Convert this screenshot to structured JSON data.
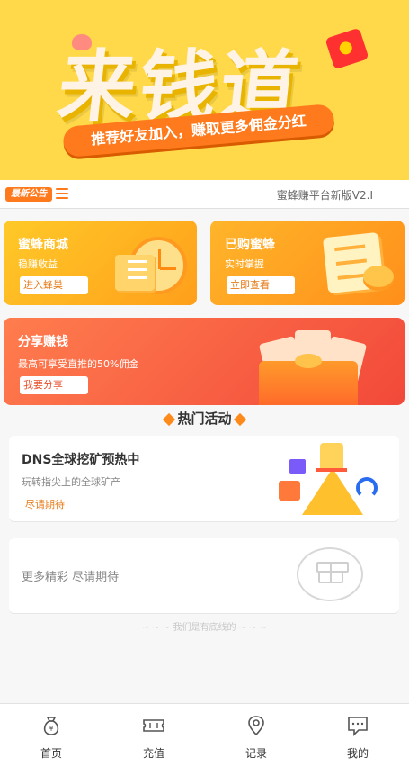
{
  "banner": {
    "title": "来钱道",
    "ribbon": "推荐好友加入，赚取更多佣金分红"
  },
  "notice": {
    "badge": "最新公告",
    "text": "蜜蜂赚平台新版V2.I"
  },
  "cards": {
    "shop": {
      "title": "蜜蜂商城",
      "subtitle": "稳赚收益",
      "button": "进入蜂巢"
    },
    "bee": {
      "title": "已购蜜蜂",
      "subtitle": "实时掌握",
      "button": "立即查看"
    },
    "share": {
      "title": "分享赚钱",
      "subtitle": "最高可享受直推的50%佣金",
      "button": "我要分享"
    }
  },
  "hot": {
    "heading": "热门活动",
    "activity": {
      "title": "DNS全球挖矿预热中",
      "subtitle": "玩转指尖上的全球矿产",
      "tag": "尽请期待"
    },
    "more": {
      "text": "更多精彩 尽请期待"
    },
    "bottom_line": "~ ~ ~ 我们是有底线的 ~ ~ ~"
  },
  "tabbar": {
    "items": [
      {
        "label": "首页",
        "icon": "money-bag-icon"
      },
      {
        "label": "充值",
        "icon": "ticket-icon"
      },
      {
        "label": "记录",
        "icon": "location-pin-icon"
      },
      {
        "label": "我的",
        "icon": "chat-icon"
      }
    ]
  },
  "colors": {
    "banner_bg": "#ffd94a",
    "accent_orange": "#ff7a1c",
    "share_red": "#f2493a"
  }
}
